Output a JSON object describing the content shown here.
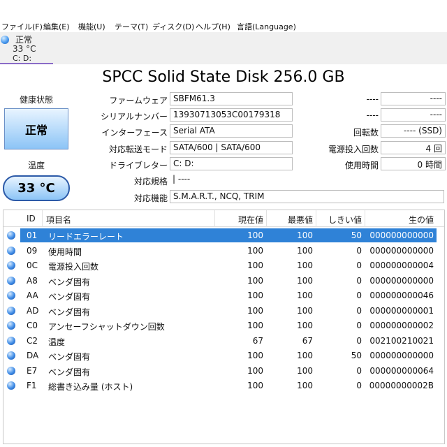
{
  "menu": [
    "ファイル(F)",
    "編集(E)",
    "機能(U)",
    "テーマ(T)",
    "ディスク(D)",
    "ヘルプ(H)",
    "言語(Language)"
  ],
  "disk_tab": {
    "status": "正常",
    "temp": "33 °C",
    "drives": "C: D:"
  },
  "title": "SPCC Solid State Disk 256.0 GB",
  "health": {
    "label": "健康状態",
    "value": "正常"
  },
  "temperature": {
    "label": "温度",
    "value": "33 °C"
  },
  "info": {
    "firmware_label": "ファームウェア",
    "firmware": "SBFM61.3",
    "serial_label": "シリアルナンバー",
    "serial": "13930713053C00179318",
    "interface_label": "インターフェース",
    "interface": "Serial ATA",
    "transfer_label": "対応転送モード",
    "transfer": "SATA/600 | SATA/600",
    "drive_letter_label": "ドライブレター",
    "drive_letter": "C: D:",
    "standard_label": "対応規格",
    "standard": "| ----",
    "features_label": "対応機能",
    "features": "S.M.A.R.T., NCQ, TRIM"
  },
  "right": {
    "r1_label": "----",
    "r1_value": "----",
    "r2_label": "----",
    "r2_value": "----",
    "rotation_label": "回転数",
    "rotation": "---- (SSD)",
    "power_on_count_label": "電源投入回数",
    "power_on_count": "4 回",
    "power_on_hours_label": "使用時間",
    "power_on_hours": "0 時間"
  },
  "table": {
    "headers": {
      "id": "ID",
      "name": "項目名",
      "current": "現在値",
      "worst": "最悪値",
      "threshold": "しきい値",
      "raw": "生の値"
    },
    "rows": [
      {
        "id": "01",
        "name": "リードエラーレート",
        "current": "100",
        "worst": "100",
        "threshold": "50",
        "raw": "000000000000"
      },
      {
        "id": "09",
        "name": "使用時間",
        "current": "100",
        "worst": "100",
        "threshold": "0",
        "raw": "000000000000"
      },
      {
        "id": "0C",
        "name": "電源投入回数",
        "current": "100",
        "worst": "100",
        "threshold": "0",
        "raw": "000000000004"
      },
      {
        "id": "A8",
        "name": "ベンダ固有",
        "current": "100",
        "worst": "100",
        "threshold": "0",
        "raw": "000000000000"
      },
      {
        "id": "AA",
        "name": "ベンダ固有",
        "current": "100",
        "worst": "100",
        "threshold": "0",
        "raw": "000000000046"
      },
      {
        "id": "AD",
        "name": "ベンダ固有",
        "current": "100",
        "worst": "100",
        "threshold": "0",
        "raw": "000000000001"
      },
      {
        "id": "C0",
        "name": "アンセーフシャットダウン回数",
        "current": "100",
        "worst": "100",
        "threshold": "0",
        "raw": "000000000002"
      },
      {
        "id": "C2",
        "name": "温度",
        "current": "67",
        "worst": "67",
        "threshold": "0",
        "raw": "002100210021"
      },
      {
        "id": "DA",
        "name": "ベンダ固有",
        "current": "100",
        "worst": "100",
        "threshold": "50",
        "raw": "000000000000"
      },
      {
        "id": "E7",
        "name": "ベンダ固有",
        "current": "100",
        "worst": "100",
        "threshold": "0",
        "raw": "000000000064"
      },
      {
        "id": "F1",
        "name": "総書き込み量 (ホスト)",
        "current": "100",
        "worst": "100",
        "threshold": "0",
        "raw": "00000000002B"
      }
    ]
  }
}
